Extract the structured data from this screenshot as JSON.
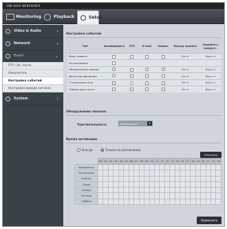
{
  "app": {
    "title": "SNB-6004 WEBVIEWER"
  },
  "tabs": [
    {
      "label": "Monitoring",
      "icon": "monitor-icon"
    },
    {
      "label": "Playback",
      "icon": "playback-icon"
    },
    {
      "label": "Setup",
      "icon": "setup-icon"
    }
  ],
  "sidebar": {
    "groups": [
      {
        "label": "Video & Audio",
        "icon": "video-icon"
      },
      {
        "label": "Network",
        "icon": "network-icon"
      },
      {
        "label": "Event",
        "icon": "event-icon"
      },
      {
        "label": "System",
        "icon": "system-icon"
      }
    ],
    "event_items": [
      "FTP / Эл. почта",
      "Накопитель",
      "Настройка событий",
      "Настройка вывода сигнала тревоги"
    ]
  },
  "event_settings": {
    "title": "Настройки событий",
    "headers": [
      "Тип",
      "Активировать",
      "FTP",
      "E-mail",
      "Запись",
      "Выход тревоги",
      "Перейти к предуст."
    ],
    "rows": [
      {
        "name": "Вход тревоги",
        "output": "Нет",
        "preset": "Выкл."
      },
      {
        "name": "Распознавани",
        "output": "",
        "preset": ""
      },
      {
        "name": "Обнаружение пропав",
        "output": "Нет",
        "preset": "Выкл."
      },
      {
        "name": "Детектор движения",
        "output": "Нет",
        "preset": "Выкл."
      },
      {
        "name": "Отключение сети",
        "output": "Нет",
        "preset": "Выкл."
      },
      {
        "name": "Таймер дост.польз",
        "output": "Нет",
        "preset": "Выкл."
      }
    ]
  },
  "detection": {
    "title": "Обнаружение звонков",
    "sensitivity_label": "Чувствительность",
    "sensitivity_value": "Нормальные"
  },
  "activation": {
    "title": "Время активации",
    "always_label": "Всегда",
    "schedule_label": "Только по расписанию",
    "clear_label": "Очистить",
    "hours": [
      "00",
      "01",
      "02",
      "03",
      "04",
      "05",
      "06",
      "07",
      "08",
      "09",
      "10",
      "11",
      "12",
      "13",
      "14",
      "15",
      "16",
      "17",
      "18",
      "19",
      "20",
      "21",
      "22",
      "23"
    ],
    "days": [
      "Воскресенье",
      "Понедельник",
      "Вторник",
      "Среда",
      "Четверг",
      "Пятница",
      "Суббота"
    ]
  },
  "apply_label": "Применить"
}
